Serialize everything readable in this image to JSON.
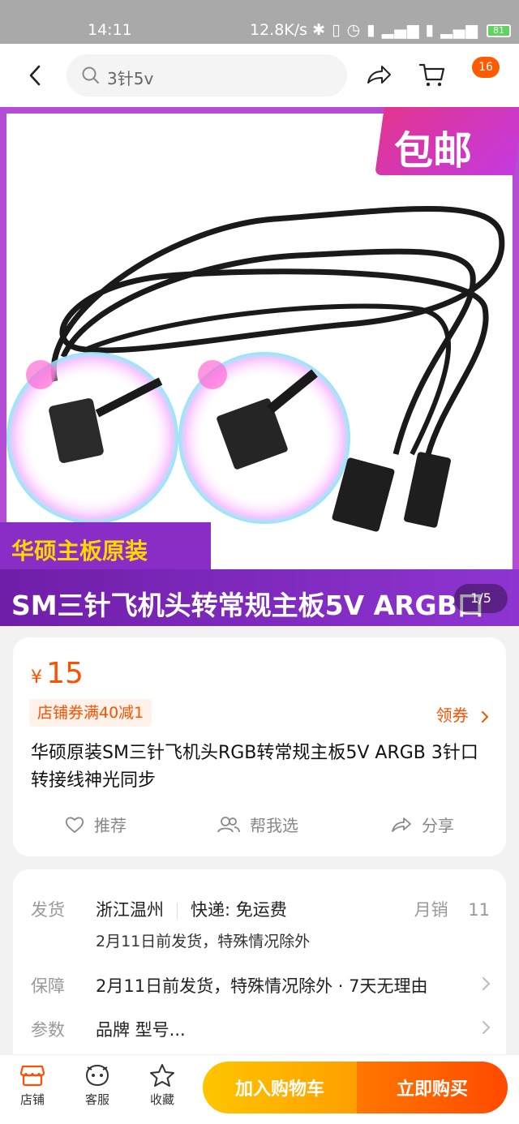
{
  "status_bar": {
    "time": "14:11",
    "network_speed": "12.8K/s",
    "battery": "81"
  },
  "nav": {
    "search_text": "3针5v",
    "cart_badge": "16"
  },
  "gallery": {
    "promo": "包邮",
    "brand_tag": "华硕主板原装",
    "caption": "SM三针飞机头转常规主板5V ARGB口",
    "counter": "1/5"
  },
  "product": {
    "currency": "¥",
    "price": "15",
    "coupon": "店铺券满40减1",
    "coupon_link": "领券",
    "title": "华硕原装SM三针飞机头RGB转常规主板5V ARGB 3针口转接线神光同步",
    "actions": {
      "recommend": "推荐",
      "help_choose": "帮我选",
      "share": "分享"
    }
  },
  "shipping": {
    "ship_label": "发货",
    "origin": "浙江温州",
    "express": "快递: 免运费",
    "monthly_label": "月销",
    "monthly_value": "11",
    "ship_note": "2月11日前发货，特殊情况除外",
    "guarantee_label": "保障",
    "guarantee_text": "2月11日前发货，特殊情况除外 · 7天无理由",
    "params_label": "参数",
    "params_text": "品牌 型号..."
  },
  "bottom_bar": {
    "store": "店铺",
    "service": "客服",
    "favorite": "收藏",
    "add_cart": "加入购物车",
    "buy_now": "立即购买"
  },
  "colors": {
    "accent": "#ff5000",
    "promo_purple": "#8a2cc6",
    "cart_button": "#ffb300",
    "buy_button": "#ff5a00"
  }
}
